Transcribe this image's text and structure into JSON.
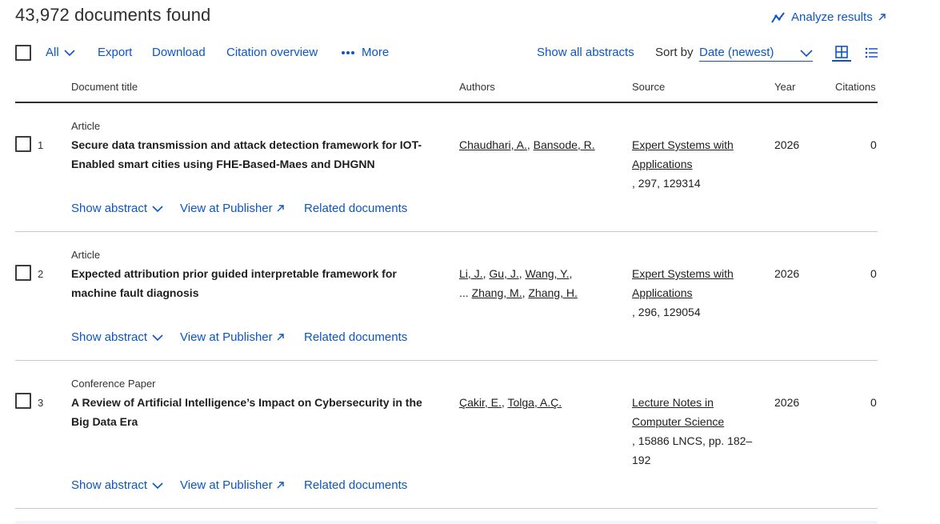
{
  "header": {
    "results_count": "43,972 documents found",
    "analyze_label": "Analyze results"
  },
  "toolbar": {
    "all_label": "All",
    "export_label": "Export",
    "download_label": "Download",
    "citation_label": "Citation overview",
    "more_label": "More",
    "show_abstracts_label": "Show all abstracts",
    "sort_by_label": "Sort by",
    "sort_value": "Date (newest)"
  },
  "columns": {
    "title": "Document title",
    "authors": "Authors",
    "source": "Source",
    "year": "Year",
    "citations": "Citations"
  },
  "actions": {
    "show_abstract": "Show abstract",
    "view_publisher": "View at Publisher",
    "related": "Related documents"
  },
  "results": [
    {
      "num": "1",
      "type": "Article",
      "title": "Secure data transmission and attack detection framework for IOT-Enabled smart cities using FHE-Based-Maes and DHGNN",
      "authors": [
        "Chaudhari, A.",
        "Bansode, R."
      ],
      "source_name": "Expert Systems with Applications",
      "source_detail": ", 297, 129314",
      "year": "2026",
      "citations": "0"
    },
    {
      "num": "2",
      "type": "Article",
      "title": "Expected attribution prior guided interpretable framework for machine fault diagnosis",
      "authors_line1": [
        "Li, J.",
        "Gu, J.",
        "Wang, Y."
      ],
      "authors_ellipsis": "...",
      "authors_line2": [
        "Zhang, M.",
        "Zhang, H."
      ],
      "source_name": "Expert Systems with Applications",
      "source_detail": ", 296, 129054",
      "year": "2026",
      "citations": "0"
    },
    {
      "num": "3",
      "type": "Conference Paper",
      "title": "A Review of Artificial Intelligence’s Impact on Cybersecurity in the Big Data Era",
      "authors": [
        "Çakir, E.",
        "Tolga, A.Ç."
      ],
      "source_name": "Lecture Notes in Computer Science",
      "source_detail": ", 15886 LNCS, pp. 182–192",
      "year": "2026",
      "citations": "0"
    }
  ],
  "colors": {
    "link": "#0c56c4",
    "text": "#2e2e2e",
    "rule": "#c9c9c9"
  }
}
